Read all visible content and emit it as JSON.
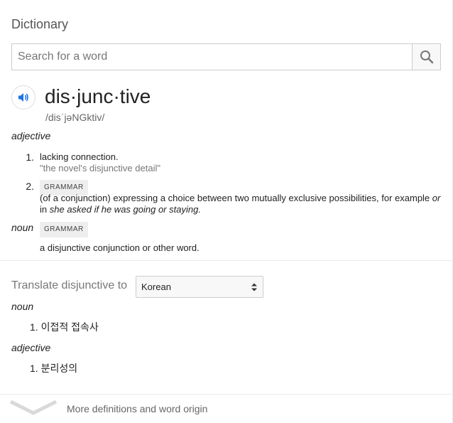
{
  "header": {
    "title": "Dictionary"
  },
  "search": {
    "placeholder": "Search for a word",
    "icon": "search-icon"
  },
  "entry": {
    "word": "dis·junc·tive",
    "phonetic": "/disˈjəNGktiv/",
    "adjective": {
      "pos": "adjective",
      "senses": [
        {
          "num": "1.",
          "definition": "lacking connection.",
          "example": "\"the novel's disjunctive detail\""
        },
        {
          "num": "2.",
          "tag": "GRAMMAR",
          "definition_prefix": "(of a conjunction) expressing a choice between two mutually exclusive possibilities, for example ",
          "definition_or": "or",
          "definition_in": " in ",
          "definition_example": "she asked if he was going or staying.",
          "definition_line2_prefix": "in"
        }
      ]
    },
    "noun": {
      "pos": "noun",
      "tag": "GRAMMAR",
      "definition": "a disjunctive conjunction or other word."
    }
  },
  "translate": {
    "label": "Translate disjunctive to",
    "language": "Korean",
    "noun": {
      "pos": "noun",
      "items": [
        {
          "num": "1.",
          "text": "이접적 접속사"
        }
      ]
    },
    "adjective": {
      "pos": "adjective",
      "items": [
        {
          "num": "1.",
          "text": "분리성의"
        }
      ]
    }
  },
  "footer": {
    "more": "More definitions and word origin"
  },
  "colors": {
    "accent": "#1a73e8",
    "divider": "#ebebeb"
  }
}
